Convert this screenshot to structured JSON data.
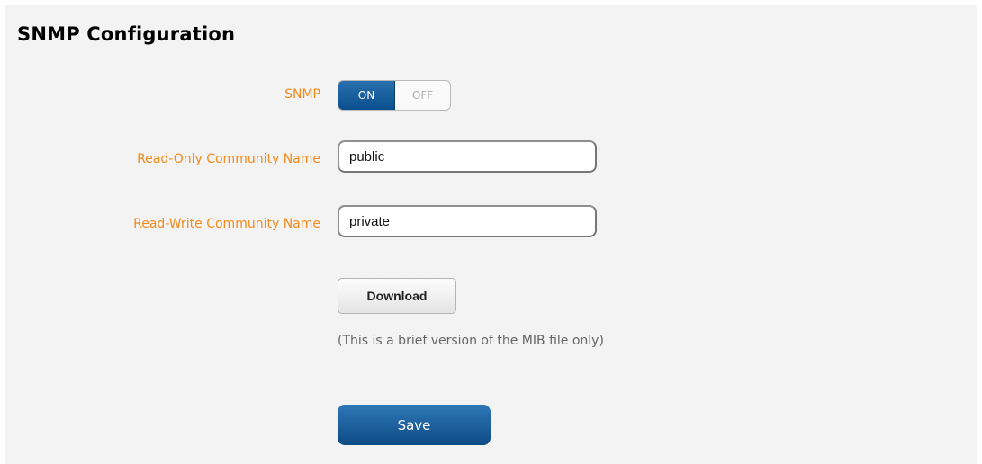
{
  "page": {
    "title": "SNMP Configuration"
  },
  "form": {
    "snmp_label": "SNMP",
    "toggle": {
      "on_label": "ON",
      "off_label": "OFF",
      "state": "ON"
    },
    "read_only_label": "Read-Only Community Name",
    "read_only_value": "public",
    "read_write_label": "Read-Write Community Name",
    "read_write_value": "private",
    "download_label": "Download",
    "download_note": "(This is a brief version of the MIB file only)",
    "save_label": "Save"
  },
  "colors": {
    "label": "#f28a1c",
    "accent": "#0d4b85",
    "panel_bg": "#f3f3f3"
  }
}
